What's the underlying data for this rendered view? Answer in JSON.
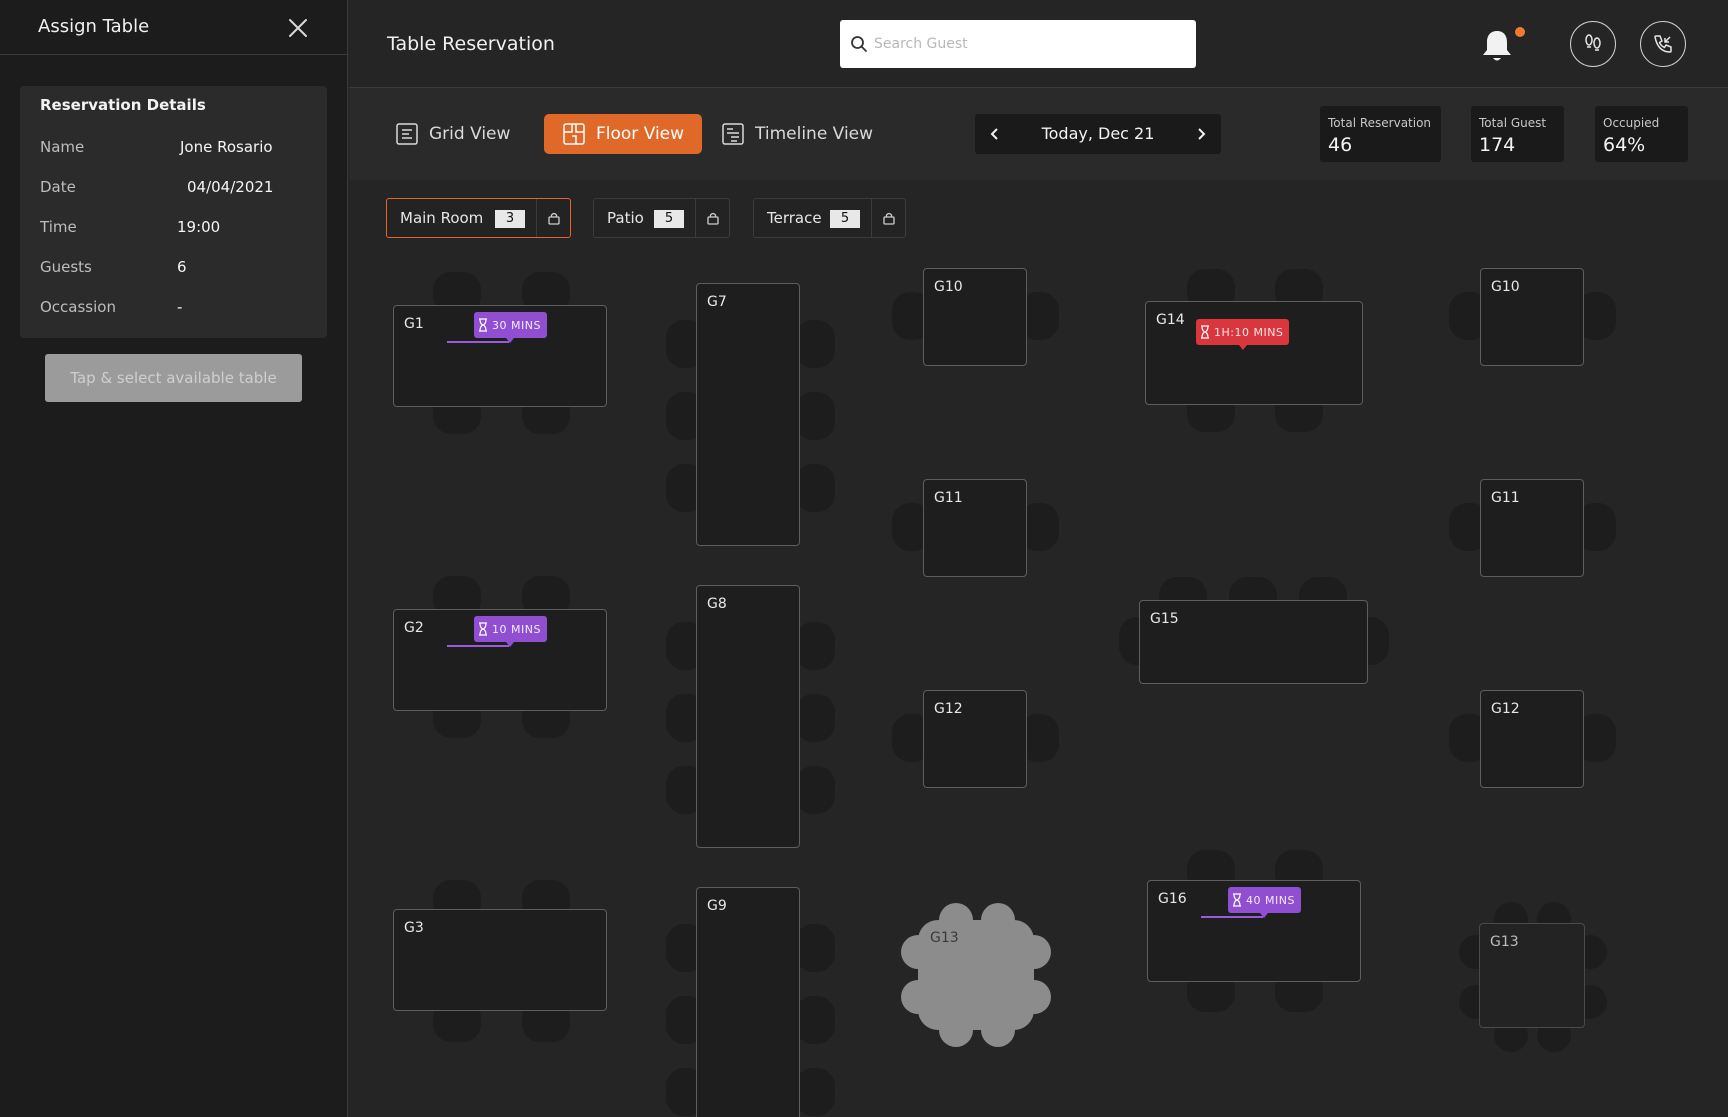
{
  "sidebar": {
    "title": "Assign Table",
    "details": {
      "title": "Reservation Details",
      "rows": [
        {
          "label": "Name",
          "value": "Jone Rosario"
        },
        {
          "label": "Date",
          "value": "04/04/2021"
        },
        {
          "label": "Time",
          "value": "19:00"
        },
        {
          "label": "Guests",
          "value": "6"
        },
        {
          "label": "Occassion",
          "value": "-"
        }
      ]
    },
    "select_button": "Tap & select available table"
  },
  "header": {
    "title": "Table Reservation",
    "search_placeholder": "Search Guest",
    "notification_accent": "#f47a2f"
  },
  "views": [
    {
      "label": "Grid View",
      "icon": "grid-view-icon"
    },
    {
      "label": "Floor View",
      "icon": "floor-view-icon",
      "active": true
    },
    {
      "label": "Timeline View",
      "icon": "timeline-view-icon"
    }
  ],
  "date_nav": {
    "label": "Today, Dec 21"
  },
  "stats": [
    {
      "label": "Total Reservation",
      "value": "46"
    },
    {
      "label": "Total Guest",
      "value": "174"
    },
    {
      "label": "Occupied",
      "value": "64%"
    }
  ],
  "areas": [
    {
      "name": "Main Room",
      "count": "3",
      "active": true
    },
    {
      "name": "Patio",
      "count": "5"
    },
    {
      "name": "Terrace",
      "count": "5"
    }
  ],
  "tables": {
    "g1": {
      "label": "G1",
      "timer": "30 MINS"
    },
    "g2": {
      "label": "G2",
      "timer": "10 MINS"
    },
    "g3": {
      "label": "G3"
    },
    "g7": {
      "label": "G7"
    },
    "g8": {
      "label": "G8"
    },
    "g9": {
      "label": "G9"
    },
    "g10a": {
      "label": "G10"
    },
    "g11a": {
      "label": "G11"
    },
    "g12a": {
      "label": "G12"
    },
    "g13a": {
      "label": "G13"
    },
    "g14": {
      "label": "G14",
      "timer": "1H:10 MINS"
    },
    "g15": {
      "label": "G15"
    },
    "g16": {
      "label": "G16",
      "timer": "40 MINS"
    },
    "g10b": {
      "label": "G10"
    },
    "g11b": {
      "label": "G11"
    },
    "g12b": {
      "label": "G12"
    },
    "g13b": {
      "label": "G13"
    }
  },
  "colors": {
    "accent": "#e0692a",
    "timer_purple": "#8f4fd0",
    "timer_red": "#d9363e"
  }
}
